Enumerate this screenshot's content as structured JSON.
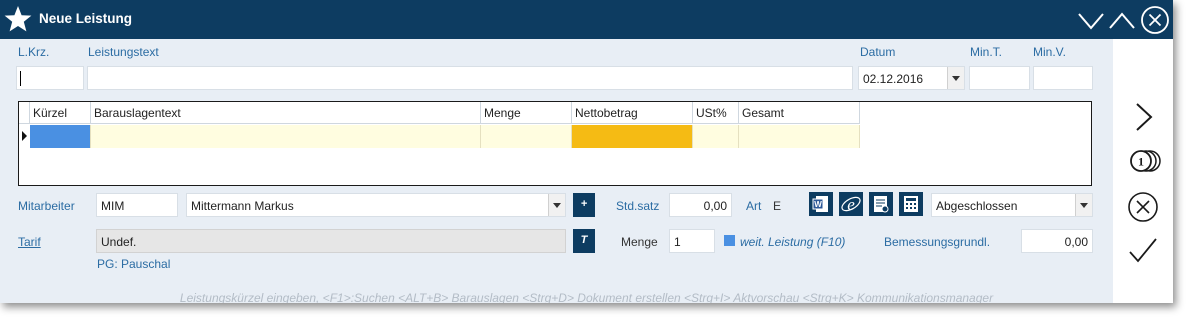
{
  "window": {
    "title": "Neue Leistung",
    "icons": [
      "star-icon",
      "chevron-down-icon",
      "chevron-up-icon",
      "close-circle-icon"
    ]
  },
  "header": {
    "lkrz_label": "L.Krz.",
    "lkrz_value": "",
    "leistungstext_label": "Leistungstext",
    "leistungstext_value": "",
    "datum_label": "Datum",
    "datum_value": "02.12.2016",
    "mint_label": "Min.T.",
    "mint_value": "",
    "minv_label": "Min.V.",
    "minv_value": ""
  },
  "grid": {
    "columns": [
      "Kürzel",
      "Barauslagentext",
      "Menge",
      "Nettobetrag",
      "USt%",
      "Gesamt"
    ],
    "rows": [
      [
        "",
        "",
        "",
        "",
        "",
        ""
      ]
    ]
  },
  "details": {
    "mitarbeiter_label": "Mitarbeiter",
    "mitarbeiter_code": "MIM",
    "mitarbeiter_name": "Mittermann Markus",
    "plus_button": "+",
    "stdsatz_label": "Std.satz",
    "stdsatz_value": "0,00",
    "art_label": "Art",
    "art_value": "E",
    "status_value": "Abgeschlossen",
    "tarif_label": "Tarif",
    "tarif_value": "Undef.",
    "t_button": "T",
    "menge_label": "Menge",
    "menge_value": "1",
    "weit_leistung_label": "weit. Leistung (F10)",
    "bemessung_label": "Bemessungsgrundl.",
    "bemessung_value": "0,00",
    "pg_text": "PG: Pauschal"
  },
  "hint": "Leistungskürzel eingeben, <F1>:Suchen <ALT+B> Barauslagen <Strg+D> Dokument erstellen <Strg+I> Aktvorschau <Strg+K> Kommunikationsmanager",
  "sidebar_icons": [
    "next-arrow-icon",
    "counter-icon",
    "cancel-circle-icon",
    "confirm-check-icon"
  ],
  "toolbar_icons": [
    "word-document-icon",
    "browser-icon",
    "document-preview-icon",
    "calculator-icon"
  ],
  "colors": {
    "titlebar": "#0d3c61",
    "background": "#e8eef5",
    "label_blue": "#2b6ca3",
    "grid_row_yellow": "#fffde0",
    "selected_cell_blue": "#4a90e2",
    "selected_cell_orange": "#f5bb14"
  }
}
